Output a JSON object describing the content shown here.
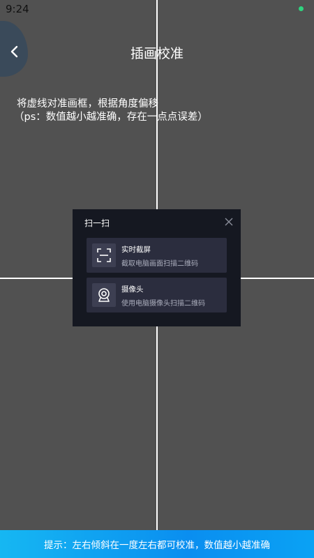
{
  "status_bar": {
    "time": "9:24",
    "indicator_color": "#2fd47f"
  },
  "header": {
    "title": "插画校准",
    "back_icon": "chevron-left-icon"
  },
  "instruction": {
    "line1": "将虚线对准画框，根据角度偏移",
    "line2": "（ps：数值越小越准确，存在一点点误差）"
  },
  "scan_dialog": {
    "title": "扫一扫",
    "close_icon": "close-icon",
    "options": [
      {
        "icon": "scan-frame-icon",
        "label": "实时截屏",
        "description": "截取电脑画面扫描二维码"
      },
      {
        "icon": "webcam-icon",
        "label": "摄像头",
        "description": "使用电脑摄像头扫描二维码"
      }
    ]
  },
  "tip_bar": {
    "text": "提示：左右倾斜在一度左右都可校准，数值越小越准确"
  },
  "colors": {
    "background": "#515151",
    "crosshair": "#ffffff",
    "dialog_bg": "#151821",
    "option_bg": "#2b2d3e",
    "tip_bar": "#0a8ef0"
  }
}
